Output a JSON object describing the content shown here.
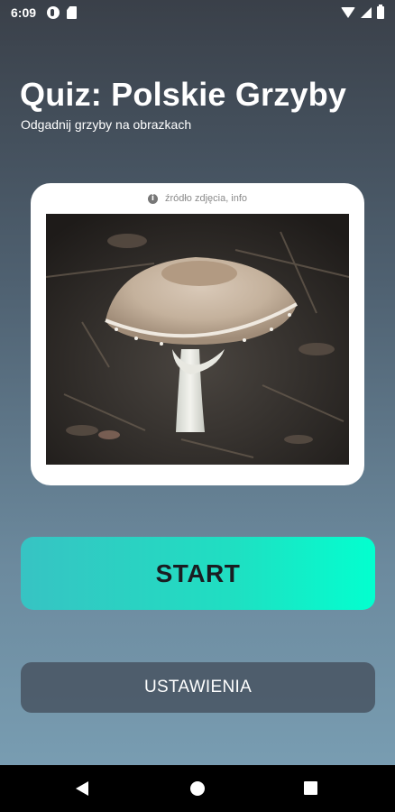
{
  "status_bar": {
    "time": "6:09",
    "icons": [
      "notification-icon",
      "sd-card-icon",
      "wifi-icon",
      "signal-icon",
      "battery-icon"
    ]
  },
  "header": {
    "title": "Quiz: Polskie Grzyby",
    "subtitle": "Odgadnij grzyby na obrazkach"
  },
  "image_card": {
    "info_icon": "info-icon",
    "info_text": "źródło zdjęcia, info",
    "image_subject": "mushroom photo"
  },
  "buttons": {
    "start_label": "START",
    "settings_label": "USTAWIENIA"
  },
  "colors": {
    "start_gradient_left": "#37c3c3",
    "start_gradient_right": "#03ffcf",
    "background_top": "#3a4049",
    "background_bottom": "#7ba1b6"
  },
  "nav_bar": {
    "icons": [
      "back-icon",
      "home-icon",
      "recent-apps-icon"
    ]
  }
}
